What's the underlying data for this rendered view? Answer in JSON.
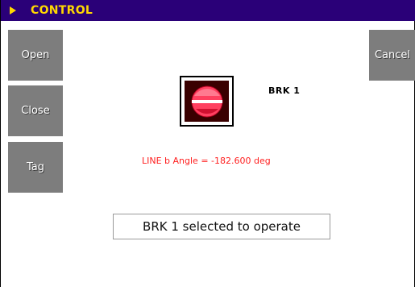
{
  "window": {
    "title": "CONTROL",
    "title_color": "#ffd800",
    "titlebar_color": "#2a0078"
  },
  "buttons": {
    "open_label": "Open",
    "close_label": "Close",
    "tag_label": "Tag",
    "cancel_label": "Cancel",
    "button_color": "#7d7d7d"
  },
  "breaker": {
    "label": "BRK 1",
    "icon": "breaker-state-icon",
    "fill_color": "#ff4060",
    "background_color": "#3a0000"
  },
  "measurement": {
    "angle_text": "LINE b Angle = -182.600 deg",
    "text_color": "#ff2020"
  },
  "status": {
    "message": "BRK 1 selected to operate"
  }
}
